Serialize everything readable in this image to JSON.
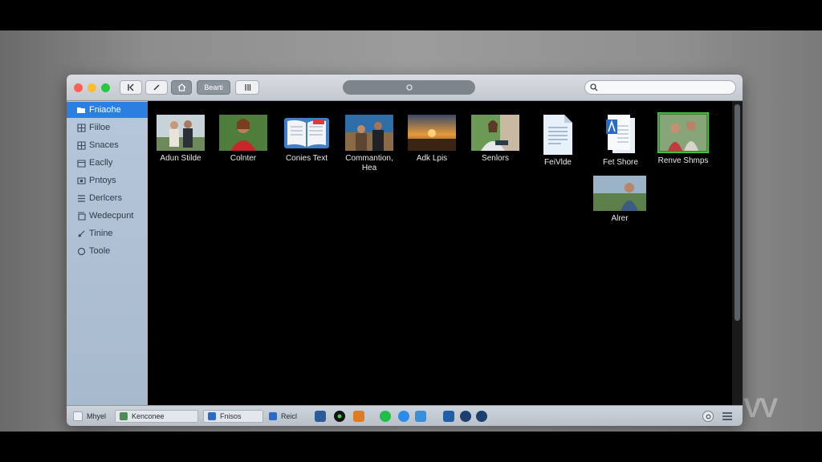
{
  "window": {
    "controls": [
      "close",
      "minimize",
      "zoom"
    ]
  },
  "toolbar": {
    "view_label": "Bearti",
    "search_placeholder": ""
  },
  "sidebar": {
    "items": [
      {
        "label": "Fniaohe",
        "icon": "folder-icon",
        "selected": true
      },
      {
        "label": "Fiiloe",
        "icon": "grid-icon",
        "selected": false
      },
      {
        "label": "Snaces",
        "icon": "grid-icon",
        "selected": false
      },
      {
        "label": "Eaclly",
        "icon": "calendar-icon",
        "selected": false
      },
      {
        "label": "Pntoys",
        "icon": "photo-icon",
        "selected": false
      },
      {
        "label": "Derlcers",
        "icon": "list-icon",
        "selected": false
      },
      {
        "label": "Wedecpunt",
        "icon": "stack-icon",
        "selected": false
      },
      {
        "label": "Tinine",
        "icon": "pen-icon",
        "selected": false
      },
      {
        "label": "Toole",
        "icon": "circle-icon",
        "selected": false
      }
    ]
  },
  "files": [
    {
      "name": "Adun Stilde",
      "kind": "photo"
    },
    {
      "name": "Colnter",
      "kind": "photo"
    },
    {
      "name": "Conies Text",
      "kind": "book"
    },
    {
      "name": "Commantion, Hea",
      "kind": "photo"
    },
    {
      "name": "Adk Lpis",
      "kind": "photo"
    },
    {
      "name": "Senlors",
      "kind": "photo"
    },
    {
      "name": "FeiVlde",
      "kind": "document"
    },
    {
      "name": "Fet Shore",
      "kind": "document"
    },
    {
      "name": "Renve Shmps",
      "kind": "photo"
    },
    {
      "name": "Alrer",
      "kind": "photo"
    }
  ],
  "dock": {
    "items": [
      {
        "label": "Mhyel"
      },
      {
        "label": "Kenconee"
      },
      {
        "label": "Fnisos"
      },
      {
        "label": "Reicl"
      }
    ]
  },
  "watermark": "VV",
  "colors": {
    "accent": "#2b7fe0",
    "sidebar": "#b0c2d5",
    "content_background": "#000000"
  }
}
